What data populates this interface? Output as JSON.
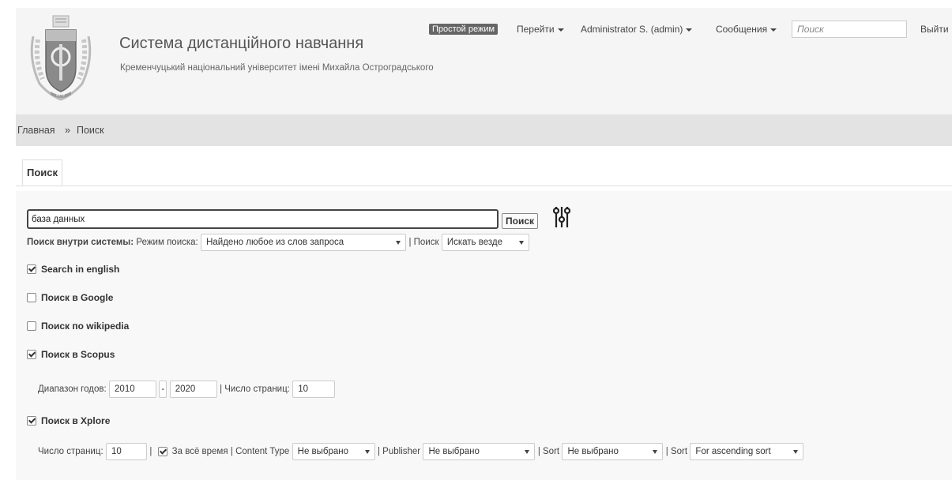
{
  "header": {
    "title": "Система дистанційного навчання",
    "subtitle": "Кременчуцький національний університет імені Михайла Остроградського",
    "simple_mode": "Простой режим",
    "nav_goto": "Перейти",
    "nav_user": "Administrator S. (admin)",
    "nav_messages": "Сообщения",
    "search_placeholder": "Поиск",
    "exit": "Выйти"
  },
  "breadcrumb": {
    "home": "Главная",
    "separator": "»",
    "current": "Поиск"
  },
  "tab": {
    "label": "Поиск"
  },
  "search": {
    "query": "база данных",
    "button": "Поиск"
  },
  "internal": {
    "label": "Поиск внутри системы:",
    "mode_label": "Режим поиска:",
    "mode_value": "Найдено любое из слов запроса",
    "scope_label": "| Поиск",
    "scope_value": "Искать везде"
  },
  "options": {
    "english": {
      "label": "Search in english",
      "checked": true
    },
    "google": {
      "label": "Поиск в Google",
      "checked": false
    },
    "wikipedia": {
      "label": "Поиск по wikipedia",
      "checked": false
    },
    "scopus": {
      "label": "Поиск в Scopus",
      "checked": true
    },
    "xplore": {
      "label": "Поиск в Xplore",
      "checked": true
    }
  },
  "scopus": {
    "years_label": "Диапазон годов:",
    "year_from": "2010",
    "dash": "-",
    "year_to": "2020",
    "pages_label": "| Число страниц:",
    "pages": "10"
  },
  "xplore": {
    "pages_label": "Число страниц:",
    "pages": "10",
    "sep1": "|",
    "all_time_label": "За всё время",
    "content_type_label": "| Content Type",
    "content_type_value": "Не выбрано",
    "publisher_label": "| Publisher",
    "publisher_value": "Не выбрано",
    "sort1_label": "| Sort",
    "sort1_value": "Не выбрано",
    "sort2_label": "| Sort",
    "sort2_value": "For ascending sort"
  },
  "icons": {
    "logo": "university-crest-icon",
    "settings": "sliders-icon"
  },
  "colors": {
    "header_bg": "#f5f5f5",
    "breadcrumb_bg": "#e3e3e3",
    "badge_bg": "#666666"
  }
}
